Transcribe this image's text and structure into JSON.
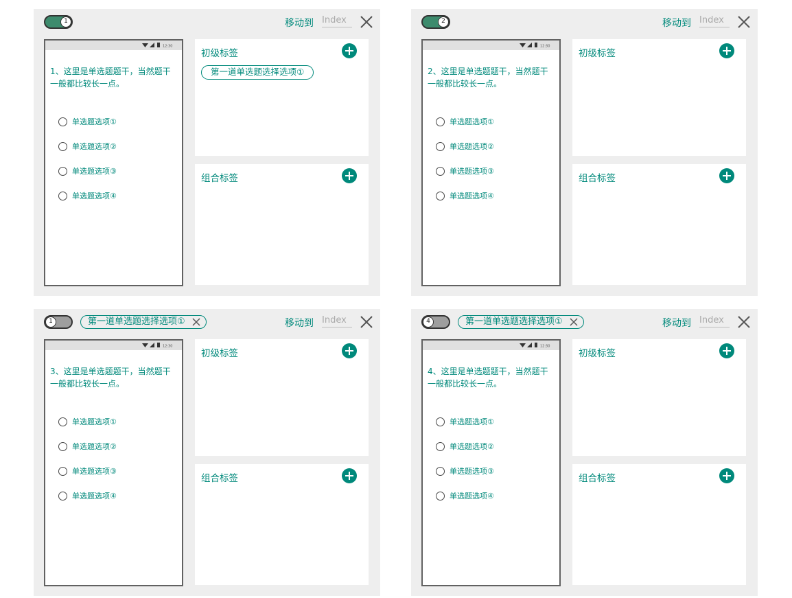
{
  "colors": {
    "accent": "#00897b",
    "panel_bg": "#eeeeee",
    "toggle_on": "#3d8b6d",
    "toggle_off": "#9e9e9e"
  },
  "panels": [
    {
      "toggle_state": "on",
      "toggle_number": "1",
      "header_chip": null,
      "move_to_label": "移动到",
      "index_placeholder": "Index",
      "status_time": "12:30",
      "question": "1、这里是单选题题干，当然题干一般都比较长一点。",
      "options": [
        "单选题选项①",
        "单选题选项②",
        "单选题选项③",
        "单选题选项④"
      ],
      "basic_tags_title": "初级标签",
      "basic_tags": [
        "第一道单选题选择选项①"
      ],
      "combo_tags_title": "组合标签"
    },
    {
      "toggle_state": "on",
      "toggle_number": "2",
      "header_chip": null,
      "move_to_label": "移动到",
      "index_placeholder": "Index",
      "status_time": "12:30",
      "question": "2、这里是单选题题干，当然题干一般都比较长一点。",
      "options": [
        "单选题选项①",
        "单选题选项②",
        "单选题选项③",
        "单选题选项④"
      ],
      "basic_tags_title": "初级标签",
      "basic_tags": [],
      "combo_tags_title": "组合标签"
    },
    {
      "toggle_state": "off",
      "toggle_number": "1",
      "header_chip": "第一道单选题选择选项①",
      "move_to_label": "移动到",
      "index_placeholder": "Index",
      "status_time": "12:30",
      "question": "3、这里是单选题题干，当然题干一般都比较长一点。",
      "options": [
        "单选题选项①",
        "单选题选项②",
        "单选题选项③",
        "单选题选项④"
      ],
      "basic_tags_title": "初级标签",
      "basic_tags": [],
      "combo_tags_title": "组合标签"
    },
    {
      "toggle_state": "off",
      "toggle_number": "4",
      "header_chip": "第一道单选题选择选项①",
      "move_to_label": "移动到",
      "index_placeholder": "Index",
      "status_time": "12:30",
      "question": "4、这里是单选题题干，当然题干一般都比较长一点。",
      "options": [
        "单选题选项①",
        "单选题选项②",
        "单选题选项③",
        "单选题选项④"
      ],
      "basic_tags_title": "初级标签",
      "basic_tags": [],
      "combo_tags_title": "组合标签"
    }
  ]
}
